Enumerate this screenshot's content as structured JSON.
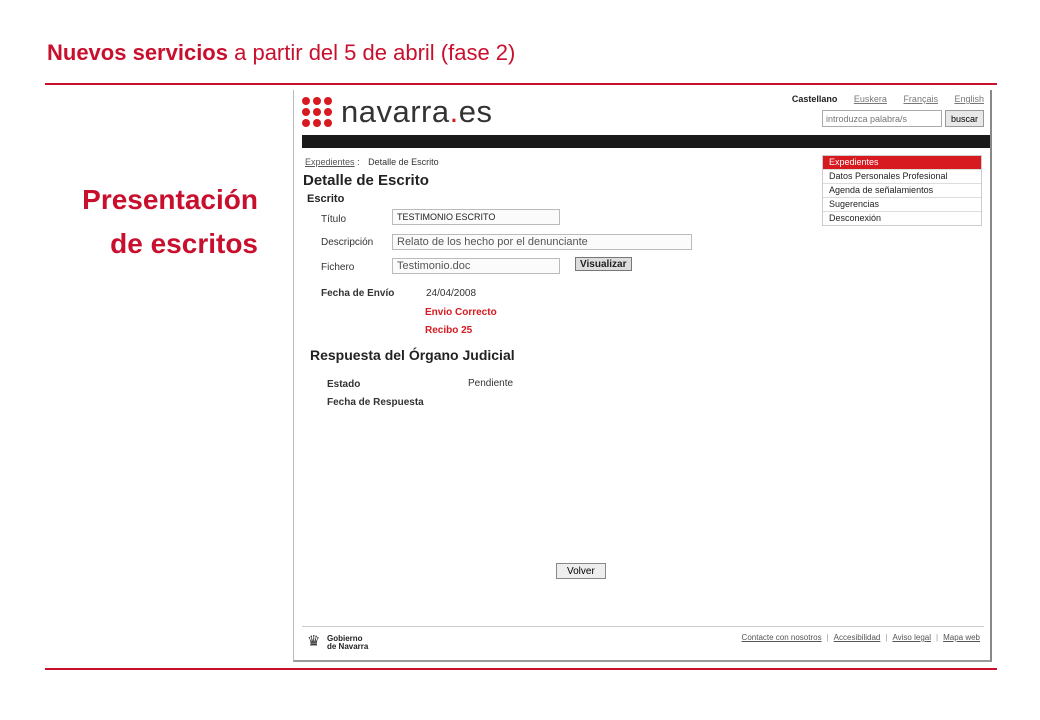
{
  "slide": {
    "title_bold": "Nuevos servicios",
    "title_rest": "a partir del 5 de abril (fase 2)",
    "side_line1": "Presentación",
    "side_line2": "de escritos"
  },
  "site": {
    "logo_name": "navarra",
    "logo_dot": ".",
    "logo_tld": "es",
    "languages": [
      "Castellano",
      "Euskera",
      "Français",
      "English"
    ],
    "search_placeholder": "introduzca palabra/s",
    "search_button": "buscar"
  },
  "breadcrumb": {
    "link": "Expedientes",
    "sep": ":",
    "current": "Detalle de Escrito"
  },
  "page": {
    "heading": "Detalle de Escrito",
    "section": "Escrito",
    "fields": {
      "titulo_label": "Título",
      "titulo_value": "TESTIMONIO ESCRITO",
      "descripcion_label": "Descripción",
      "descripcion_value": "Relato de los hecho por el denunciante",
      "fichero_label": "Fichero",
      "fichero_value": "Testimonio.doc",
      "visualizar_button": "Visualizar"
    },
    "envio": {
      "label": "Fecha de Envío",
      "date": "24/04/2008",
      "status": "Envio Correcto",
      "recibo": "Recibo 25"
    },
    "respuesta": {
      "heading": "Respuesta del Órgano Judicial",
      "estado_label": "Estado",
      "estado_value": "Pendiente",
      "fecha_label": "Fecha de Respuesta"
    },
    "volver_button": "Volver"
  },
  "menu": {
    "items": [
      "Expedientes",
      "Datos Personales Profesional",
      "Agenda de señalamientos",
      "Sugerencias",
      "Desconexión"
    ]
  },
  "footer": {
    "gobierno_line1": "Gobierno",
    "gobierno_line2": "de Navarra",
    "links": [
      "Contacte con nosotros",
      "Accesibilidad",
      "Aviso legal",
      "Mapa web"
    ]
  },
  "colors": {
    "accent": "#c8102e",
    "brand_red": "#d71920",
    "bar": "#1a1a1a"
  }
}
